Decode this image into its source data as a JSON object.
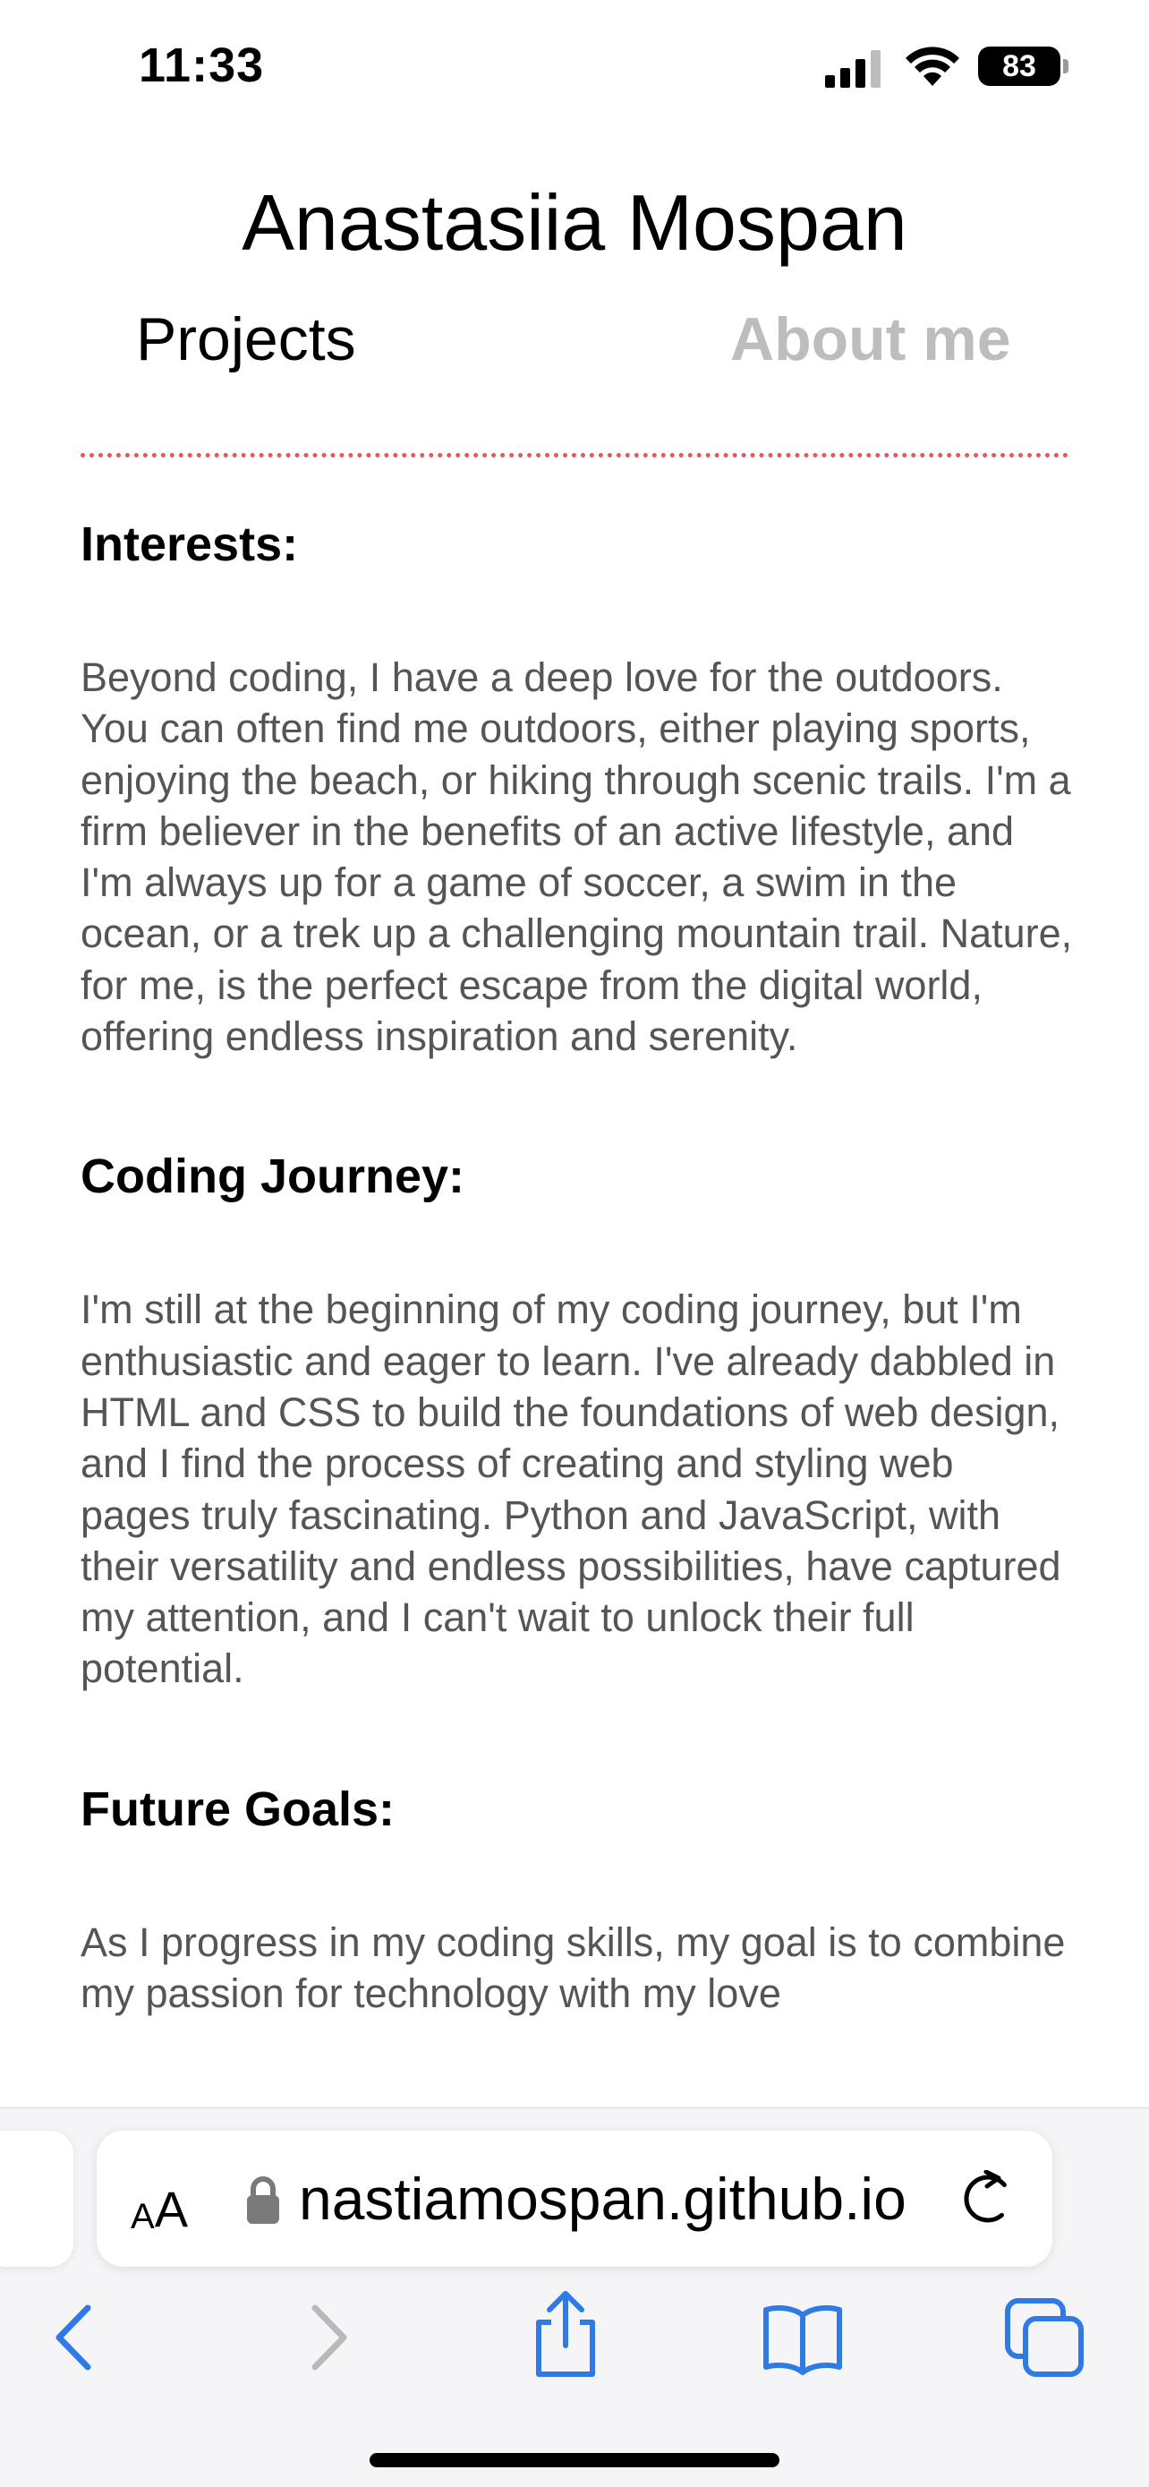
{
  "status_bar": {
    "time": "11:33",
    "battery": "83",
    "icons": [
      "signal-icon",
      "wifi-icon",
      "battery-icon"
    ]
  },
  "header": {
    "title": "Anastasiia Mospan",
    "nav": {
      "projects": "Projects",
      "about": "About me"
    }
  },
  "colors": {
    "divider": "#e4575f",
    "active_nav": "#bdbdbd",
    "body_text": "#555555",
    "toolbar_accent": "#2f7ae5"
  },
  "sections": [
    {
      "heading": "Interests:",
      "body": "Beyond coding, I have a deep love for the outdoors. You can often find me outdoors, either playing sports, enjoying the beach, or hiking through scenic trails. I'm a firm believer in the benefits of an active lifestyle, and I'm always up for a game of soccer, a swim in the ocean, or a trek up a challenging mountain trail. Nature, for me, is the perfect escape from the digital world, offering endless inspiration and serenity."
    },
    {
      "heading": "Coding Journey:",
      "body": "I'm still at the beginning of my coding journey, but I'm enthusiastic and eager to learn. I've already dabbled in HTML and CSS to build the foundations of web design, and I find the process of creating and styling web pages truly fascinating. Python and JavaScript, with their versatility and endless possibilities, have captured my attention, and I can't wait to unlock their full potential."
    },
    {
      "heading": "Future Goals:",
      "body": "As I progress in my coding skills, my goal is to combine my passion for technology with my love"
    }
  ],
  "browser": {
    "aa_label_small": "A",
    "aa_label_large": "A",
    "url": "nastiamospan.github.io",
    "icons": [
      "lock-icon",
      "reload-icon",
      "back-icon",
      "forward-icon",
      "share-icon",
      "bookmarks-icon",
      "tabs-icon"
    ]
  }
}
